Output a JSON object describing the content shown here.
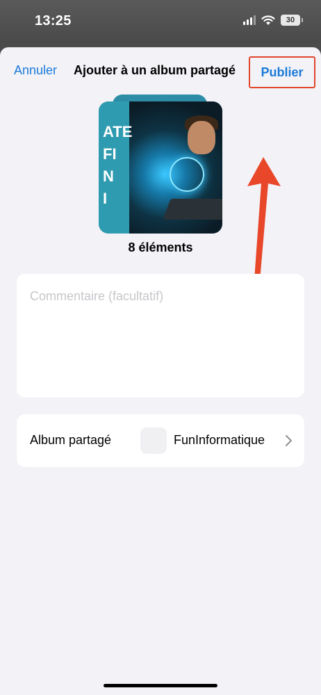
{
  "status_bar": {
    "time": "13:25",
    "battery": "30"
  },
  "nav": {
    "cancel_label": "Annuler",
    "title": "Ajouter à un album partagé",
    "publish_label": "Publier"
  },
  "preview": {
    "thumbnail_text": [
      "ATE",
      "FI",
      "N",
      "I"
    ],
    "count_label": "8 éléments"
  },
  "comment": {
    "placeholder": "Commentaire (facultatif)"
  },
  "album": {
    "label": "Album partagé",
    "value": "FunInformatique"
  },
  "colors": {
    "accent": "#1a7ad8",
    "highlight": "#e2452b",
    "background": "#f2f2f7"
  }
}
